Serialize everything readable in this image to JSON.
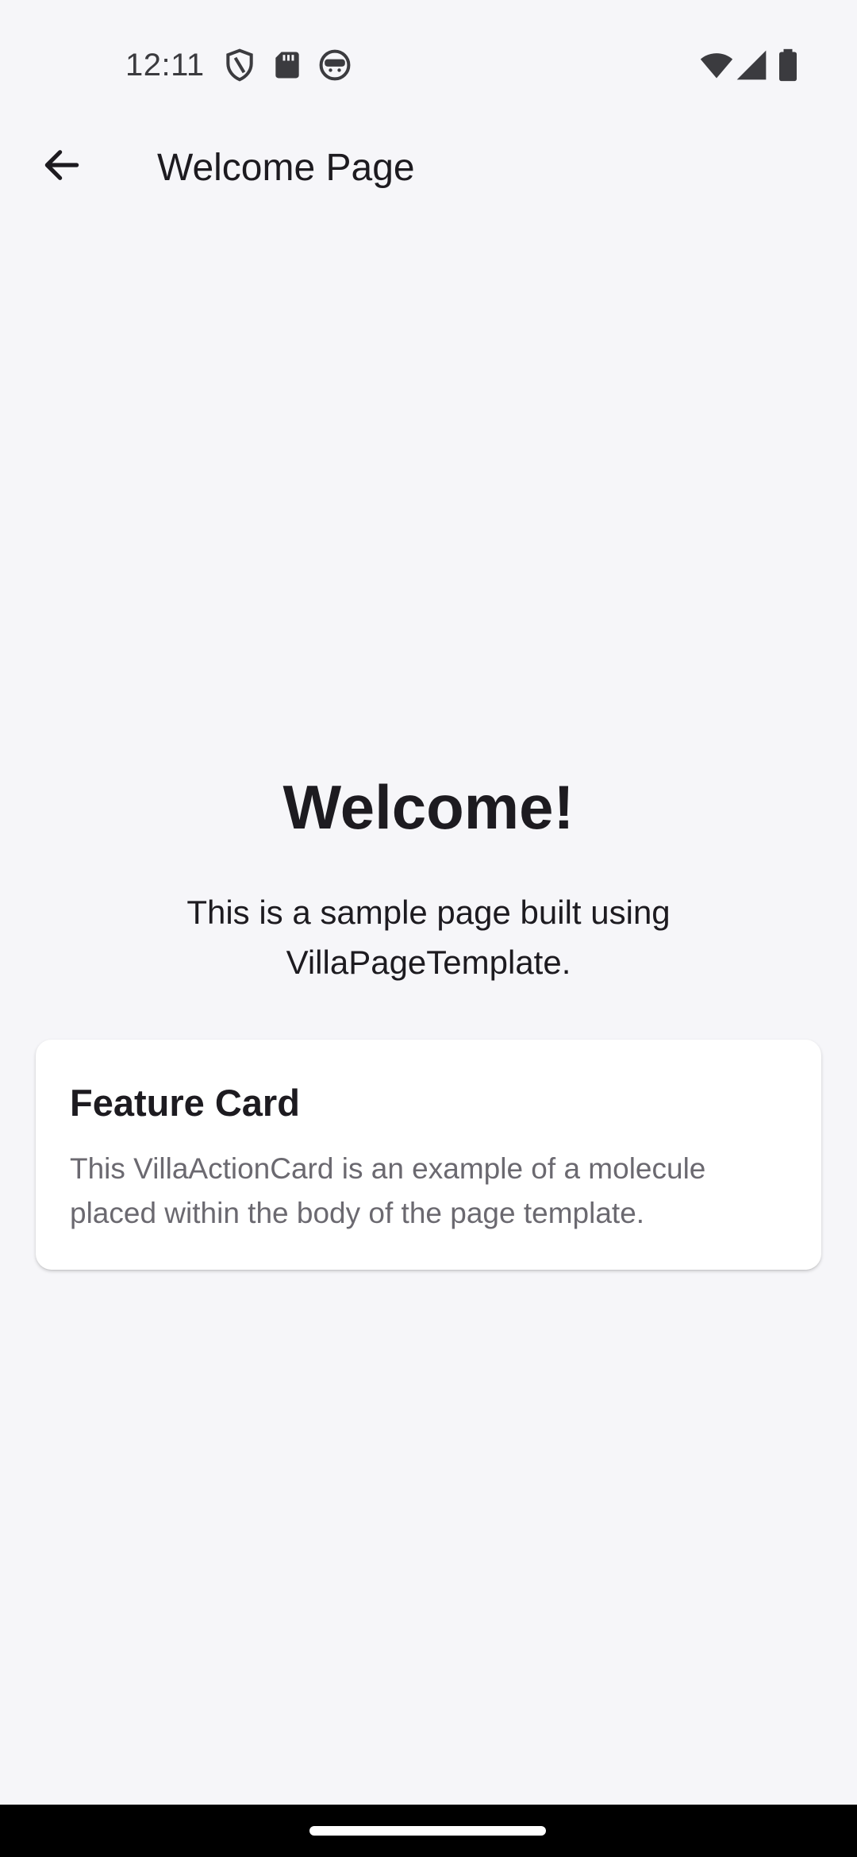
{
  "status_bar": {
    "time": "12:11",
    "left_icons": [
      "shield-icon",
      "sd-card-icon",
      "android-face-icon"
    ],
    "right_icons": [
      "wifi-icon",
      "cell-signal-icon",
      "battery-icon"
    ]
  },
  "app_bar": {
    "back_icon": "arrow-back-icon",
    "title": "Welcome Page"
  },
  "main": {
    "heading": "Welcome!",
    "subtitle": "This is a sample page built using VillaPageTemplate."
  },
  "card": {
    "title": "Feature Card",
    "body": "This VillaActionCard is an example of a molecule placed within the body of the page template."
  },
  "colors": {
    "background": "#f6f6f9",
    "card_background": "#ffffff",
    "text_primary": "#1d1b20",
    "text_secondary": "#6b6970",
    "nav_bar": "#000000"
  }
}
